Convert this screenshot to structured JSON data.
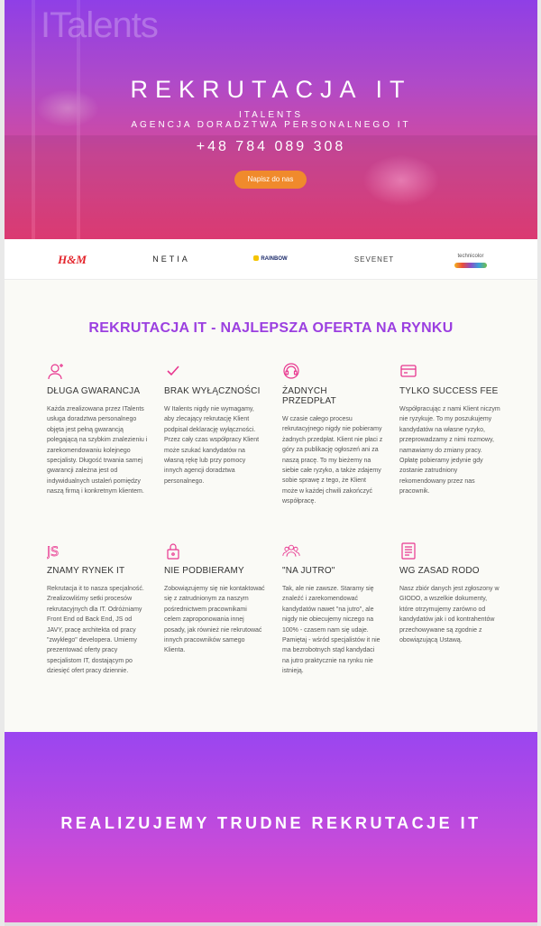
{
  "hero": {
    "logo_text": "ITalents",
    "title": "REKRUTACJA IT",
    "brand": "ITALENTS",
    "subtitle": "AGENCJA DORADZTWA PERSONALNEGO IT",
    "phone": "+48 784 089 308",
    "cta": "Napisz do nas"
  },
  "clients": [
    "H&M",
    "NETIA",
    "RAINBOW",
    "SEVENET",
    "technicolor"
  ],
  "main": {
    "title": "REKRUTACJA IT - NAJLEPSZA OFERTA NA RYNKU",
    "features": [
      {
        "icon": "user-plus-icon",
        "title": "DŁUGA GWARANCJA",
        "text": "Każda zrealizowana przez ITalents usługa doradztwa personalnego objęta jest pełną gwarancją polegającą na szybkim znalezieniu i zarekomendowaniu kolejnego specjalisty. Długość trwania samej gwarancji zależna jest od indywidualnych ustaleń pomiędzy naszą firmą i konkretnym klientem."
      },
      {
        "icon": "checkmark-icon",
        "title": "BRAK WYŁĄCZNOŚCI",
        "text": "W Italents nigdy nie wymagamy, aby zlecający rekrutację Klient podpisał deklarację wyłączności. Przez cały czas współpracy Klient może szukać kandydatów na własną rękę lub przy pomocy innych agencji doradztwa personalnego."
      },
      {
        "icon": "headset-icon",
        "title": "ŻADNYCH PRZEDPŁAT",
        "text": "W czasie całego procesu rekrutacyjnego nigdy nie pobieramy żadnych przedpłat. Klient nie płaci z góry za publikację ogłoszeń ani za naszą pracę. To my bieżemy na siebie całe ryzyko, a także zdajemy sobie sprawę z tego, że Klient może w każdej chwili zakończyć współpracę."
      },
      {
        "icon": "credit-card-icon",
        "title": "TYLKO SUCCESS FEE",
        "text": "Współpracując z nami Klient niczym nie ryzykuje. To my poszukujemy kandydatów na własne ryzyko, przeprowadzamy z nimi rozmowy, namawiamy do zmiany pracy. Opłatę pobieramy jedynie gdy zostanie zatrudniony rekomendowany przez nas pracownik."
      },
      {
        "icon": "js-icon",
        "title": "ZNAMY RYNEK IT",
        "text": "Rekrutacja it to nasza specjalność. Zrealizowliśmy setki procesów rekrutacyjnych dla IT. Odróżniamy Front End od Back End, JS od JAVY, pracę architekta od pracy \"zwykłego\" developera. Umiemy prezentować oferty pracy specjalistom IT, dostającym po dziesięć ofert pracy dziennie."
      },
      {
        "icon": "padlock-icon",
        "title": "NIE PODBIERAMY",
        "text": "Zobowiązujemy się nie kontaktować się z zatrudnionym za naszym pośrednictwem pracownikami celem zaproponowania innej posady, jak również nie rekrutować innych pracowników samego Klienta."
      },
      {
        "icon": "group-icon",
        "title": "\"NA JUTRO\"",
        "text": "Tak, ale nie zawsze. Staramy się znaleźć i zarekomendować kandydatów nawet \"na jutro\", ale nigdy nie obiecujemy niczego na 100% - czasem nam się udaje. Pamiętaj - wśród specjalistów it nie ma bezrobotnych stąd kandydaci na jutro praktycznie na rynku nie istnieją."
      },
      {
        "icon": "document-icon",
        "title": "WG ZASAD RODO",
        "text": "Nasz zbiór danych jest zgłoszony w GIODO, a wszelkie dokumenty, które otrzymujemy zarówno od kandydatów jak i od kontrahentów przechowywane są zgodnie z obowiązującą Ustawą."
      }
    ]
  },
  "band": {
    "title": "REALIZUJEMY TRUDNE REKRUTACJE IT"
  },
  "colors": {
    "accent": "#9b3fe0",
    "icon_pink": "#e8368f",
    "cta": "#f08a2c"
  }
}
